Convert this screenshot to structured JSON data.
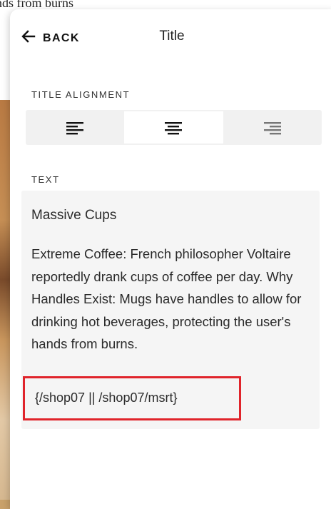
{
  "background": {
    "partial_text": "nds from burns"
  },
  "header": {
    "back_label": "BACK",
    "title": "Title"
  },
  "title_alignment": {
    "label": "TITLE ALIGNMENT",
    "options": [
      "left",
      "center",
      "right"
    ],
    "selected": "center"
  },
  "text_section": {
    "label": "TEXT",
    "heading": "Massive Cups",
    "body": "Extreme Coffee: French philosopher Voltaire reportedly drank cups of coffee per day. Why Handles Exist: Mugs have handles to allow for drinking hot beverages, protecting the user's hands from burns.",
    "code": "{/shop07 || /shop07/msrt}"
  },
  "colors": {
    "highlight_border": "#e0242b",
    "panel_bg": "#ffffff",
    "segment_bg": "#f1f1f1"
  }
}
